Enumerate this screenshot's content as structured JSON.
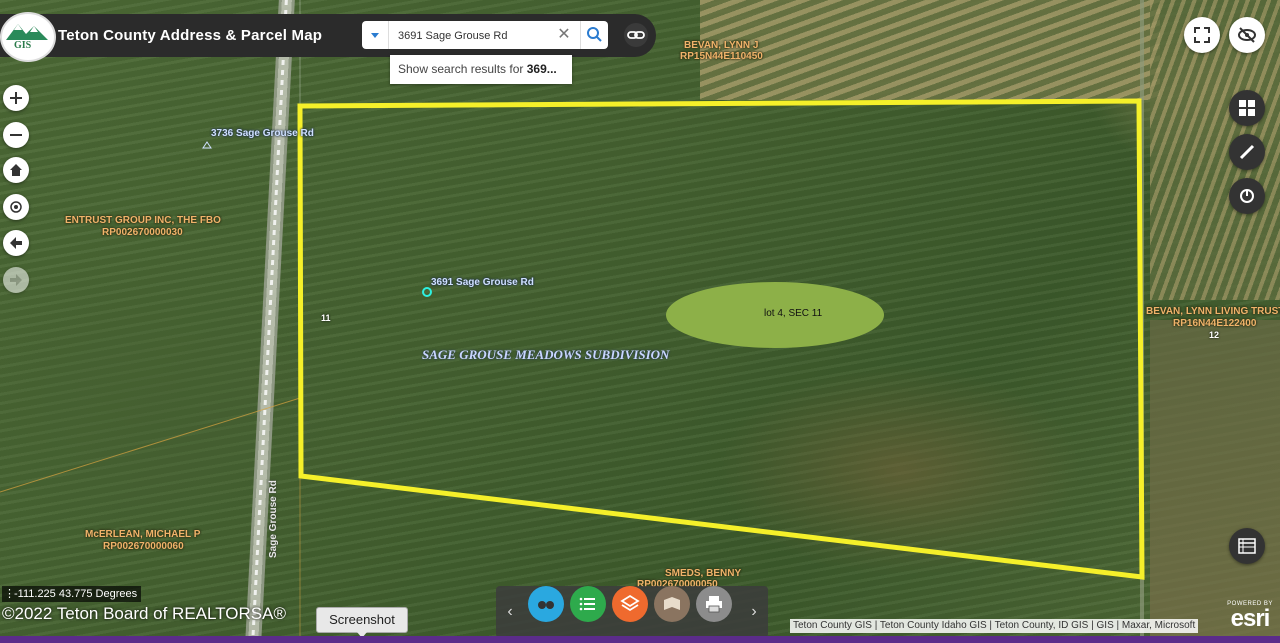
{
  "app": {
    "logo_text": "GIS",
    "title": "Teton County Address & Parcel Map"
  },
  "search": {
    "value": "3691 Sage Grouse Rd",
    "clear_icon": "close-icon",
    "search_icon": "search-icon",
    "suggestion_prefix": "Show search results for ",
    "suggestion_bold": "369..."
  },
  "map_labels": {
    "owner_top": "BEVAN, LYNN J",
    "owner_top_parcel": "RP15N44E110450",
    "addr_3736": "3736 Sage Grouse Rd",
    "owner_entrust": "ENTRUST GROUP INC, THE FBO",
    "owner_entrust_parcel": "RP002670000030",
    "addr_3691": "3691 Sage Grouse Rd",
    "section_11": "11",
    "subdivision": "SAGE GROUSE MEADOWS SUBDIVISION",
    "annotation": "lot 4, SEC 11",
    "owner_right": "BEVAN, LYNN LIVING TRUST",
    "owner_right_parcel": "RP16N44E122400",
    "section_12": "12",
    "road_vertical": "Sage Grouse Rd",
    "owner_mcerlean": "McERLEAN, MICHAEL P",
    "owner_mcerlean_parcel": "RP002670000060",
    "owner_smeds": "SMEDS, BENNY",
    "owner_smeds_parcel": "RP002670000050"
  },
  "colors": {
    "parcel_outline": "#f5f02a",
    "annotation_fill": "#8db048",
    "header_bg": "#2b2b2b",
    "bottom_bar": "#5b2c8a"
  },
  "coords": {
    "text": "-111.225 43.775 Degrees"
  },
  "copyright": "©2022 Teton Board of REALTORSA®",
  "tooltip": "Screenshot",
  "toolbar": {
    "buttons": [
      {
        "name": "basemap",
        "color": "#2aa8e0"
      },
      {
        "name": "layer-list",
        "color": "#2eaa4c"
      },
      {
        "name": "layers",
        "color": "#ef6a2e"
      },
      {
        "name": "print-map",
        "color": "#8a7460"
      },
      {
        "name": "print",
        "color": "#8c8c8c"
      }
    ]
  },
  "attribution": "Teton County GIS | Teton County Idaho GIS | Teton County, ID GIS | GIS | Maxar, Microsoft",
  "esri": {
    "powered_by": "POWERED BY",
    "name": "esri"
  }
}
